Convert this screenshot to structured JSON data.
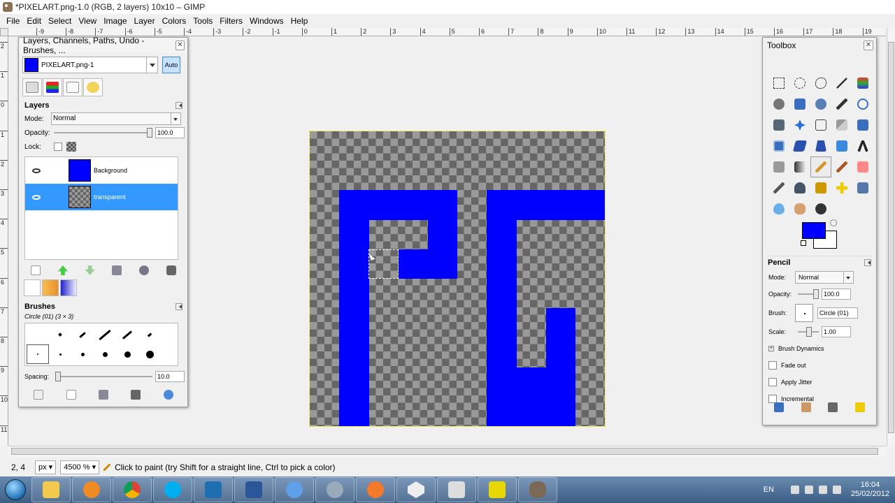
{
  "window": {
    "title": "*PIXELART.png-1.0 (RGB, 2 layers) 10x10 – GIMP"
  },
  "menu": [
    "File",
    "Edit",
    "Select",
    "View",
    "Image",
    "Layer",
    "Colors",
    "Tools",
    "Filters",
    "Windows",
    "Help"
  ],
  "rulers": {
    "horizontal": [
      "-9",
      "-8",
      "-7",
      "-6",
      "-5",
      "-4",
      "-3",
      "-2",
      "-1",
      "0",
      "1",
      "2",
      "3",
      "4",
      "5",
      "6",
      "7",
      "8",
      "9",
      "10",
      "11",
      "12",
      "13",
      "14",
      "15",
      "16",
      "17",
      "18",
      "19"
    ],
    "vertical": [
      "2",
      "1",
      "0",
      "1",
      "2",
      "3",
      "4",
      "5",
      "6",
      "7",
      "8",
      "9",
      "10",
      "11"
    ]
  },
  "canvas": {
    "grid": 10,
    "pixel_color": "#0000ff",
    "blue_pixels": [
      [
        1,
        2
      ],
      [
        2,
        2
      ],
      [
        3,
        2
      ],
      [
        4,
        2
      ],
      [
        6,
        2
      ],
      [
        7,
        2
      ],
      [
        8,
        2
      ],
      [
        9,
        2
      ],
      [
        1,
        3
      ],
      [
        4,
        3
      ],
      [
        6,
        3
      ],
      [
        1,
        4
      ],
      [
        3,
        4
      ],
      [
        4,
        4
      ],
      [
        6,
        4
      ],
      [
        1,
        5
      ],
      [
        6,
        5
      ],
      [
        1,
        6
      ],
      [
        6,
        6
      ],
      [
        8,
        6
      ],
      [
        1,
        7
      ],
      [
        6,
        7
      ],
      [
        8,
        7
      ],
      [
        1,
        8
      ],
      [
        6,
        8
      ],
      [
        7,
        8
      ],
      [
        8,
        8
      ],
      [
        1,
        9
      ],
      [
        6,
        9
      ],
      [
        7,
        9
      ],
      [
        8,
        9
      ]
    ],
    "selection_pixel": [
      2,
      4
    ]
  },
  "layers_dock": {
    "title": "Layers, Channels, Paths, Undo - Brushes, ...",
    "image_name": "PIXELART.png-1",
    "auto_label": "Auto",
    "layers_header": "Layers",
    "mode_label": "Mode:",
    "mode_value": "Normal",
    "opacity_label": "Opacity:",
    "opacity_value": "100.0",
    "lock_label": "Lock:",
    "layers": [
      {
        "name": "Background",
        "selected": false
      },
      {
        "name": "transparent",
        "selected": true
      }
    ]
  },
  "brushes_panel": {
    "header": "Brushes",
    "current": "Circle (01) (3 × 3)",
    "spacing_label": "Spacing:",
    "spacing_value": "10.0"
  },
  "toolbox": {
    "title": "Toolbox",
    "fg_color": "#0000ff",
    "bg_color": "#ffffff",
    "tool_options": {
      "tool_name": "Pencil",
      "mode_label": "Mode:",
      "mode_value": "Normal",
      "opacity_label": "Opacity:",
      "opacity_value": "100.0",
      "brush_label": "Brush:",
      "brush_value": "Circle (01)",
      "scale_label": "Scale:",
      "scale_value": "1.00",
      "brush_dynamics": "Brush Dynamics",
      "fade_out": "Fade out",
      "apply_jitter": "Apply Jitter",
      "incremental": "Incremental"
    }
  },
  "status": {
    "coords": "2, 4",
    "unit": "px",
    "zoom": "4500 %",
    "message": "Click to paint (try Shift for a straight line, Ctrl to pick a color)"
  },
  "taskbar": {
    "language": "EN",
    "time": "16:04",
    "date": "25/02/2012"
  }
}
